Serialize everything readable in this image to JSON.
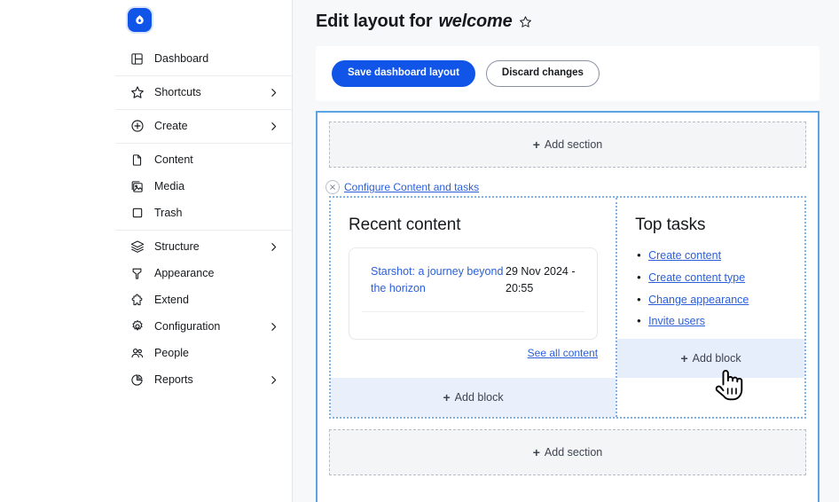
{
  "sidebar": {
    "logo_name": "drupal-logo",
    "groups": [
      {
        "items": [
          {
            "label": "Dashboard",
            "icon": "dashboard-icon",
            "chevron": false
          }
        ]
      },
      {
        "items": [
          {
            "label": "Shortcuts",
            "icon": "star-icon",
            "chevron": true
          }
        ]
      },
      {
        "items": [
          {
            "label": "Create",
            "icon": "plus-circle-icon",
            "chevron": true
          }
        ]
      },
      {
        "items": [
          {
            "label": "Content",
            "icon": "file-icon",
            "chevron": false
          },
          {
            "label": "Media",
            "icon": "image-icon",
            "chevron": false
          },
          {
            "label": "Trash",
            "icon": "trash-square-icon",
            "chevron": false
          }
        ]
      },
      {
        "items": [
          {
            "label": "Structure",
            "icon": "layers-icon",
            "chevron": true
          },
          {
            "label": "Appearance",
            "icon": "paintbrush-icon",
            "chevron": false
          },
          {
            "label": "Extend",
            "icon": "puzzle-icon",
            "chevron": false
          },
          {
            "label": "Configuration",
            "icon": "gear-icon",
            "chevron": true
          },
          {
            "label": "People",
            "icon": "people-icon",
            "chevron": false
          },
          {
            "label": "Reports",
            "icon": "chart-pie-icon",
            "chevron": true
          }
        ]
      }
    ]
  },
  "header": {
    "title_prefix": "Edit layout for",
    "title_emphasis": "welcome",
    "star_icon": "star-outline-icon"
  },
  "toolbar": {
    "save_label": "Save dashboard layout",
    "discard_label": "Discard changes"
  },
  "layout": {
    "add_section_top": "Add section",
    "add_section_bottom": "Add section",
    "section": {
      "configure_label": "Configure Content and tasks",
      "close_icon": "close-icon",
      "left_block": {
        "title": "Recent content",
        "rows": [
          {
            "title": "Starshot: a journey beyond the horizon",
            "date": "29 Nov 2024 - 20:55"
          }
        ],
        "see_all_label": "See all content",
        "add_block_label": "Add block"
      },
      "right_block": {
        "title": "Top tasks",
        "tasks": [
          "Create content",
          "Create content type",
          "Change appearance",
          "Invite users"
        ],
        "add_block_label": "Add block"
      }
    }
  },
  "colors": {
    "brand_blue": "#1055e8",
    "link_blue": "#2b5fd9",
    "region_border": "#5ba4e5",
    "dotted_border": "#7fb2e8",
    "add_block_bg": "#eaf0fb"
  },
  "cursor": {
    "type": "pointing-hand-cursor"
  }
}
